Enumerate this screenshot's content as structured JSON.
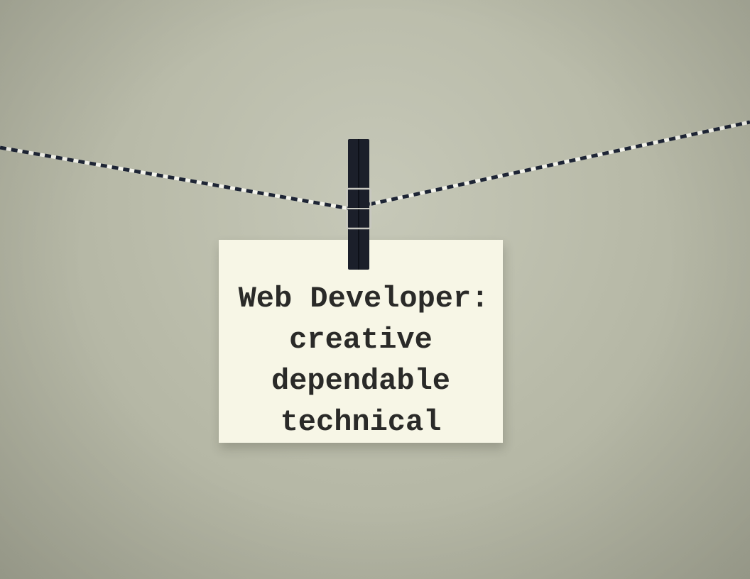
{
  "image": {
    "subject": "clothespin-on-twine",
    "colors": {
      "wall": "#bcbeac",
      "card": "#f7f6e6",
      "text": "#2a2a28",
      "peg": "#1b1f2a",
      "twine_dark": "#1e2535",
      "twine_light": "#f2f2ea"
    }
  },
  "note_card": {
    "lines": [
      "Web Developer:",
      "creative",
      "dependable",
      "technical"
    ]
  }
}
